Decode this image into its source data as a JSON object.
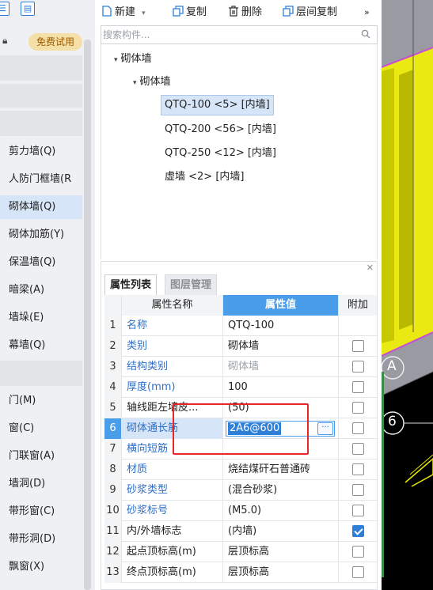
{
  "left_panel": {
    "top_icons": [
      "list-view-icon",
      "tree-view-icon"
    ],
    "trial_badge": "免费试用",
    "nav_items": [
      {
        "label": "剪力墙(Q)",
        "selected": false
      },
      {
        "label": "人防门框墙(R",
        "selected": false
      },
      {
        "label": "砌体墙(Q)",
        "selected": true
      },
      {
        "label": "砌体加筋(Y)",
        "selected": false
      },
      {
        "label": "保温墙(Q)",
        "selected": false
      },
      {
        "label": "暗梁(A)",
        "selected": false
      },
      {
        "label": "墙垛(E)",
        "selected": false
      },
      {
        "label": "幕墙(Q)",
        "selected": false
      },
      {
        "label": "门(M)",
        "selected": false
      },
      {
        "label": "窗(C)",
        "selected": false
      },
      {
        "label": "门联窗(A)",
        "selected": false
      },
      {
        "label": "墙洞(D)",
        "selected": false
      },
      {
        "label": "带形窗(C)",
        "selected": false
      },
      {
        "label": "带形洞(D)",
        "selected": false
      },
      {
        "label": "飘窗(X)",
        "selected": false
      }
    ]
  },
  "toolbar": {
    "new_label": "新建",
    "copy_label": "复制",
    "delete_label": "删除",
    "floor_copy_label": "层间复制",
    "more_label": "»"
  },
  "search": {
    "placeholder": "搜索构件...",
    "value": ""
  },
  "tree": {
    "root_label": "砌体墙",
    "group_label": "砌体墙",
    "items": [
      {
        "label": "QTQ-100 <5> [内墙]",
        "selected": true
      },
      {
        "label": "QTQ-200 <56> [内墙]",
        "selected": false
      },
      {
        "label": "QTQ-250 <12> [内墙]",
        "selected": false
      },
      {
        "label": "虚墙 <2> [内墙]",
        "selected": false
      }
    ]
  },
  "properties": {
    "tabs": [
      "属性列表",
      "图层管理"
    ],
    "active_tab": "属性列表",
    "columns": {
      "name": "属性名称",
      "value": "属性值",
      "extra": "附加"
    },
    "rows": [
      {
        "no": "1",
        "name": "名称",
        "value": "QTQ-100",
        "checked": null
      },
      {
        "no": "2",
        "name": "类别",
        "value": "砌体墙",
        "checked": false
      },
      {
        "no": "3",
        "name": "结构类别",
        "value": "砌体墙",
        "checked": false
      },
      {
        "no": "4",
        "name": "厚度(mm)",
        "value": "100",
        "checked": false
      },
      {
        "no": "5",
        "name": "轴线距左墙皮...",
        "value": "(50)",
        "checked": false
      },
      {
        "no": "6",
        "name": "砌体通长筋",
        "value": "2A6@600",
        "checked": false
      },
      {
        "no": "7",
        "name": "横向短筋",
        "value": "",
        "checked": false
      },
      {
        "no": "8",
        "name": "材质",
        "value": "烧结煤矸石普通砖",
        "checked": false
      },
      {
        "no": "9",
        "name": "砂浆类型",
        "value": "(混合砂浆)",
        "checked": false
      },
      {
        "no": "10",
        "name": "砂浆标号",
        "value": "(M5.0)",
        "checked": false
      },
      {
        "no": "11",
        "name": "内/外墙标志",
        "value": "(内墙)",
        "checked": true
      },
      {
        "no": "12",
        "name": "起点顶标高(m)",
        "value": "层顶标高",
        "checked": false
      },
      {
        "no": "13",
        "name": "终点顶标高(m)",
        "value": "层顶标高",
        "checked": false
      }
    ],
    "editing_row": "6"
  },
  "viewport": {
    "axis_labels": [
      "A",
      "6"
    ],
    "colors": {
      "wall": "#eaea12",
      "wall_shade": "#b9b900",
      "slab": "#9a9aa3",
      "edge": "#c94bd6",
      "background": "#000000"
    }
  }
}
